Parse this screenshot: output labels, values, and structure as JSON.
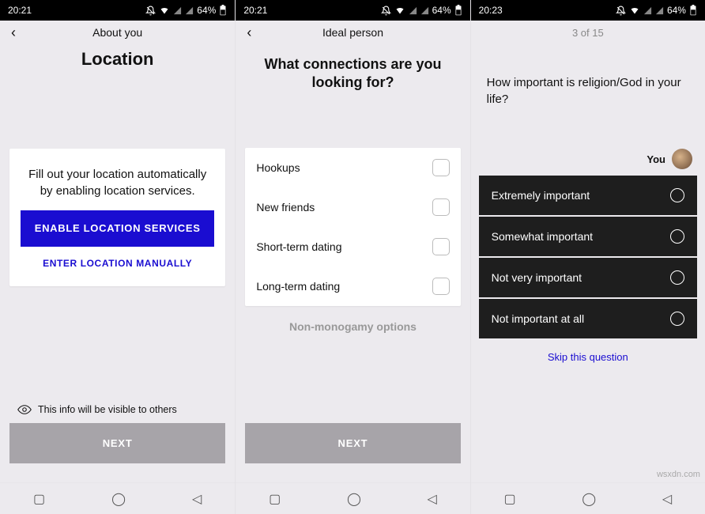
{
  "status": {
    "time1": "20:21",
    "time2": "20:21",
    "time3": "20:23",
    "battery": "64%"
  },
  "screen1": {
    "subtitle": "About you",
    "title": "Location",
    "card_text": "Fill out your location automatically by enabling location services.",
    "enable_btn": "ENABLE LOCATION SERVICES",
    "manual_link": "ENTER LOCATION MANUALLY",
    "visibility_text": "This info will be visible to others",
    "next": "NEXT"
  },
  "screen2": {
    "subtitle": "Ideal person",
    "title": "What connections are you looking for?",
    "options": [
      "Hookups",
      "New friends",
      "Short-term dating",
      "Long-term dating"
    ],
    "nonmono": "Non-monogamy options",
    "next": "NEXT"
  },
  "screen3": {
    "counter": "3 of 15",
    "question": "How important is religion/God in your life?",
    "you_label": "You",
    "options": [
      "Extremely important",
      "Somewhat important",
      "Not very important",
      "Not important at all"
    ],
    "skip": "Skip this question"
  },
  "watermark": "wsxdn.com"
}
